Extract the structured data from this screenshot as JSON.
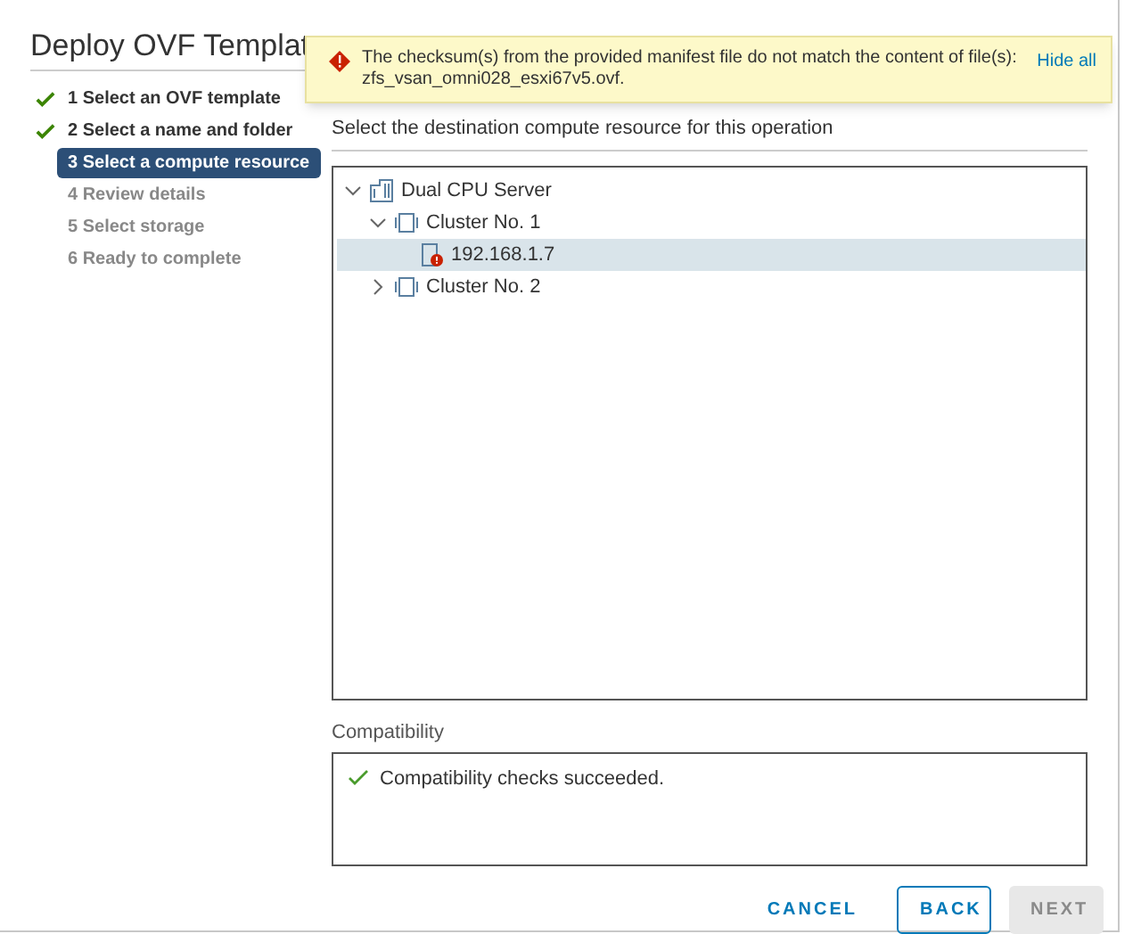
{
  "window": {
    "title": "Deploy OVF Templat"
  },
  "alert": {
    "message": "The checksum(s) from the provided manifest file do not match the content of file(s): zfs_vsan_omni028_esxi67v5.ovf.",
    "action": "Hide all"
  },
  "steps": [
    {
      "label": "1 Select an OVF template",
      "done": true,
      "selected": false
    },
    {
      "label": "2 Select a name and folder",
      "done": true,
      "selected": false
    },
    {
      "label": "3 Select a compute resource",
      "done": false,
      "selected": true
    },
    {
      "label": "4 Review details",
      "done": false,
      "selected": false
    },
    {
      "label": "5 Select storage",
      "done": false,
      "selected": false
    },
    {
      "label": "6 Ready to complete",
      "done": false,
      "selected": false
    }
  ],
  "instruction": "Select the destination compute resource for this operation",
  "tree": [
    {
      "label": "Dual CPU Server",
      "kind": "datacenter",
      "expanded": true,
      "selected": false,
      "children": [
        {
          "label": "Cluster No. 1",
          "kind": "cluster",
          "expanded": true,
          "selected": false,
          "children": [
            {
              "label": "192.168.1.7",
              "kind": "host-error",
              "selected": true
            }
          ]
        },
        {
          "label": "Cluster No. 2",
          "kind": "cluster",
          "expanded": false,
          "selected": false
        }
      ]
    }
  ],
  "compatibility": {
    "label": "Compatibility",
    "message": "Compatibility checks succeeded."
  },
  "buttons": [
    {
      "label": "CANCEL",
      "kind": "flat",
      "disabled": false
    },
    {
      "label": "BACK",
      "kind": "outline",
      "disabled": false
    },
    {
      "label": "NEXT",
      "kind": "solid",
      "disabled": true
    }
  ]
}
